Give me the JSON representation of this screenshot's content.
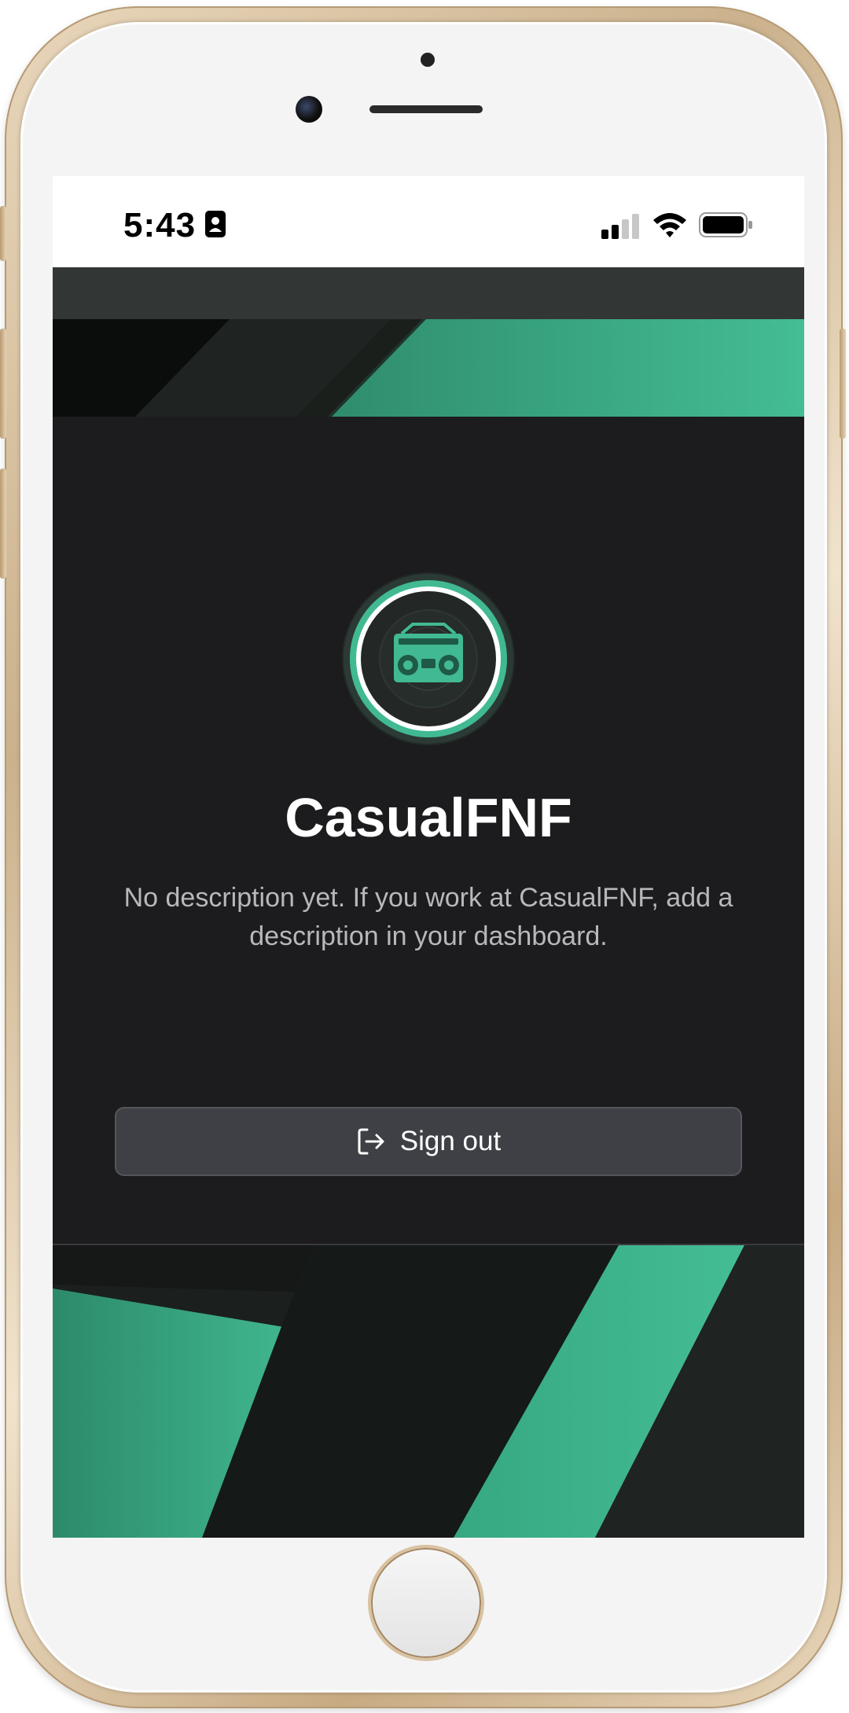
{
  "status_bar": {
    "time": "5:43",
    "icons": [
      "contact-card-icon",
      "cellular-signal-icon",
      "wifi-icon",
      "battery-icon"
    ]
  },
  "profile": {
    "name": "CasualFNF",
    "description": "No description yet. If you work at CasualFNF, add a description in your dashboard.",
    "avatar_icon": "boombox-icon"
  },
  "actions": {
    "sign_out_label": "Sign out",
    "sign_out_icon": "sign-out-icon"
  },
  "colors": {
    "accent": "#41b993",
    "background": "#1c1c1e",
    "button": "#3f4045"
  }
}
